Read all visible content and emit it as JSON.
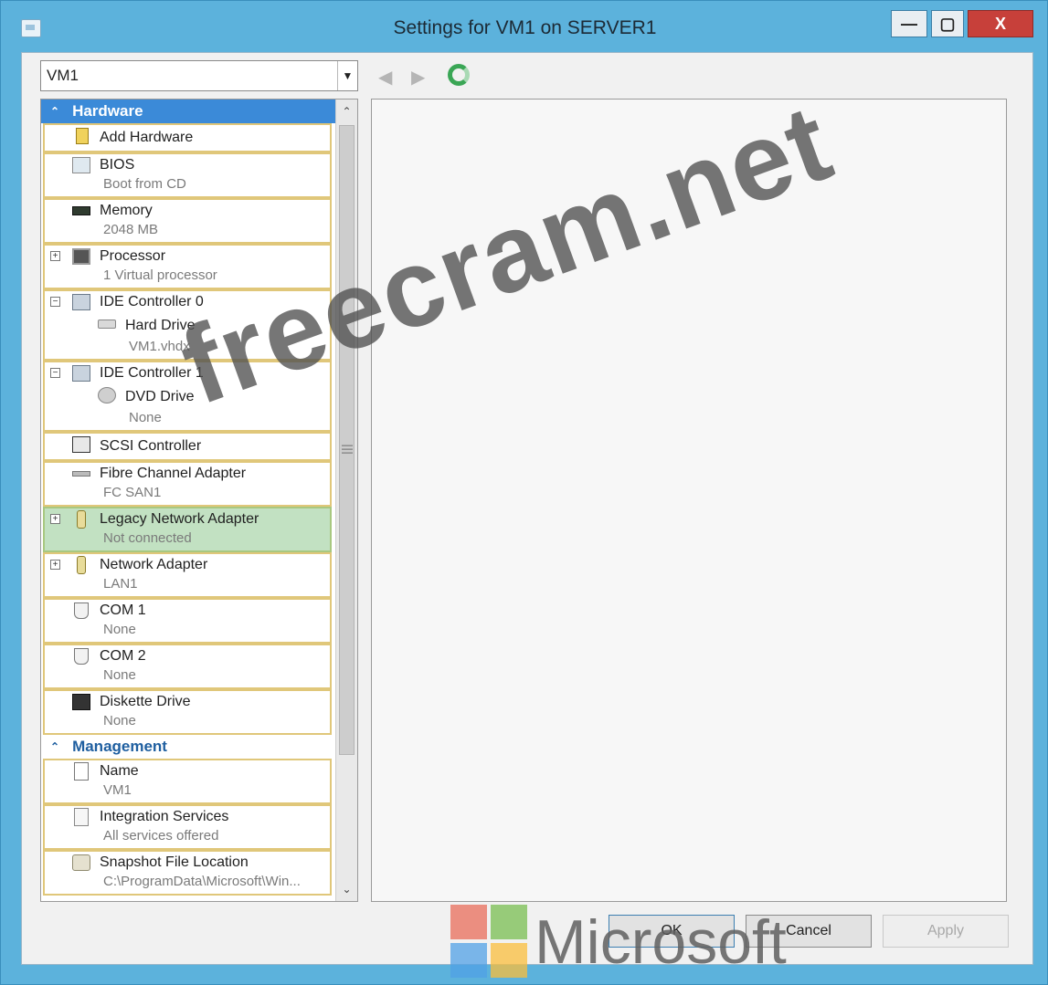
{
  "window": {
    "title": "Settings for VM1 on SERVER1",
    "min_label": "—",
    "max_label": "▢",
    "close_label": "X"
  },
  "vm_selector": {
    "value": "VM1"
  },
  "nav": {
    "back": "◀",
    "forward": "▶"
  },
  "tree": {
    "hardware_label": "Hardware",
    "management_label": "Management",
    "hardware_items": [
      {
        "name": "Add Hardware"
      },
      {
        "name": "BIOS",
        "sub": "Boot from CD"
      },
      {
        "name": "Memory",
        "sub": "2048 MB"
      },
      {
        "name": "Processor",
        "sub": "1 Virtual processor"
      },
      {
        "name": "IDE Controller 0",
        "child": "Hard Drive",
        "child_sub": "VM1.vhdx"
      },
      {
        "name": "IDE Controller 1",
        "child": "DVD Drive",
        "child_sub": "None"
      },
      {
        "name": "SCSI Controller"
      },
      {
        "name": "Fibre Channel Adapter",
        "sub": "FC SAN1"
      },
      {
        "name": "Legacy Network Adapter",
        "sub": "Not connected"
      },
      {
        "name": "Network Adapter",
        "sub": "LAN1"
      },
      {
        "name": "COM 1",
        "sub": "None"
      },
      {
        "name": "COM 2",
        "sub": "None"
      },
      {
        "name": "Diskette Drive",
        "sub": "None"
      }
    ],
    "management_items": [
      {
        "name": "Name",
        "sub": "VM1"
      },
      {
        "name": "Integration Services",
        "sub": "All services offered"
      },
      {
        "name": "Snapshot File Location",
        "sub": "C:\\ProgramData\\Microsoft\\Win..."
      }
    ]
  },
  "buttons": {
    "ok": "OK",
    "cancel": "Cancel",
    "apply": "Apply"
  },
  "watermarks": {
    "site": "freecram.net",
    "brand": "Microsoft"
  }
}
